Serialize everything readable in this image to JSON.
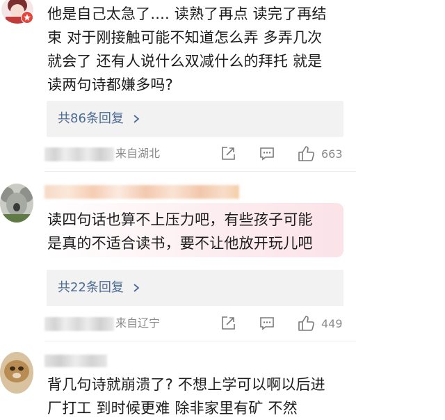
{
  "comments": [
    {
      "text": "他是自己太急了.... 读熟了再点 读完了再结\n束 对于刚接触可能不知道怎么弄 多弄几次\n就会了 还有人说什么双减什么的拜托 就是\n读两句诗都嫌多吗?",
      "reply_label": "共86条回复",
      "location": "来自湖北",
      "likes": "663"
    },
    {
      "text": "读四句话也算不上压力吧，有些孩子可能\n是真的不适合读书，要不让他放开玩儿吧",
      "reply_label": "共22条回复",
      "location": "来自辽宁",
      "likes": "449"
    },
    {
      "text": "背几句诗就崩溃了? 不想上学可以啊以后进\n厂打工 到时候更难 除非家里有矿 不然"
    }
  ],
  "icons": {
    "reply_arrow": "chevron-right-icon",
    "share": "share-icon",
    "comment": "comment-icon",
    "like": "thumbs-up-icon"
  },
  "colors": {
    "link": "#4a6a93",
    "meta": "#8b8b8b",
    "reply_bg": "#f2f2f2"
  }
}
